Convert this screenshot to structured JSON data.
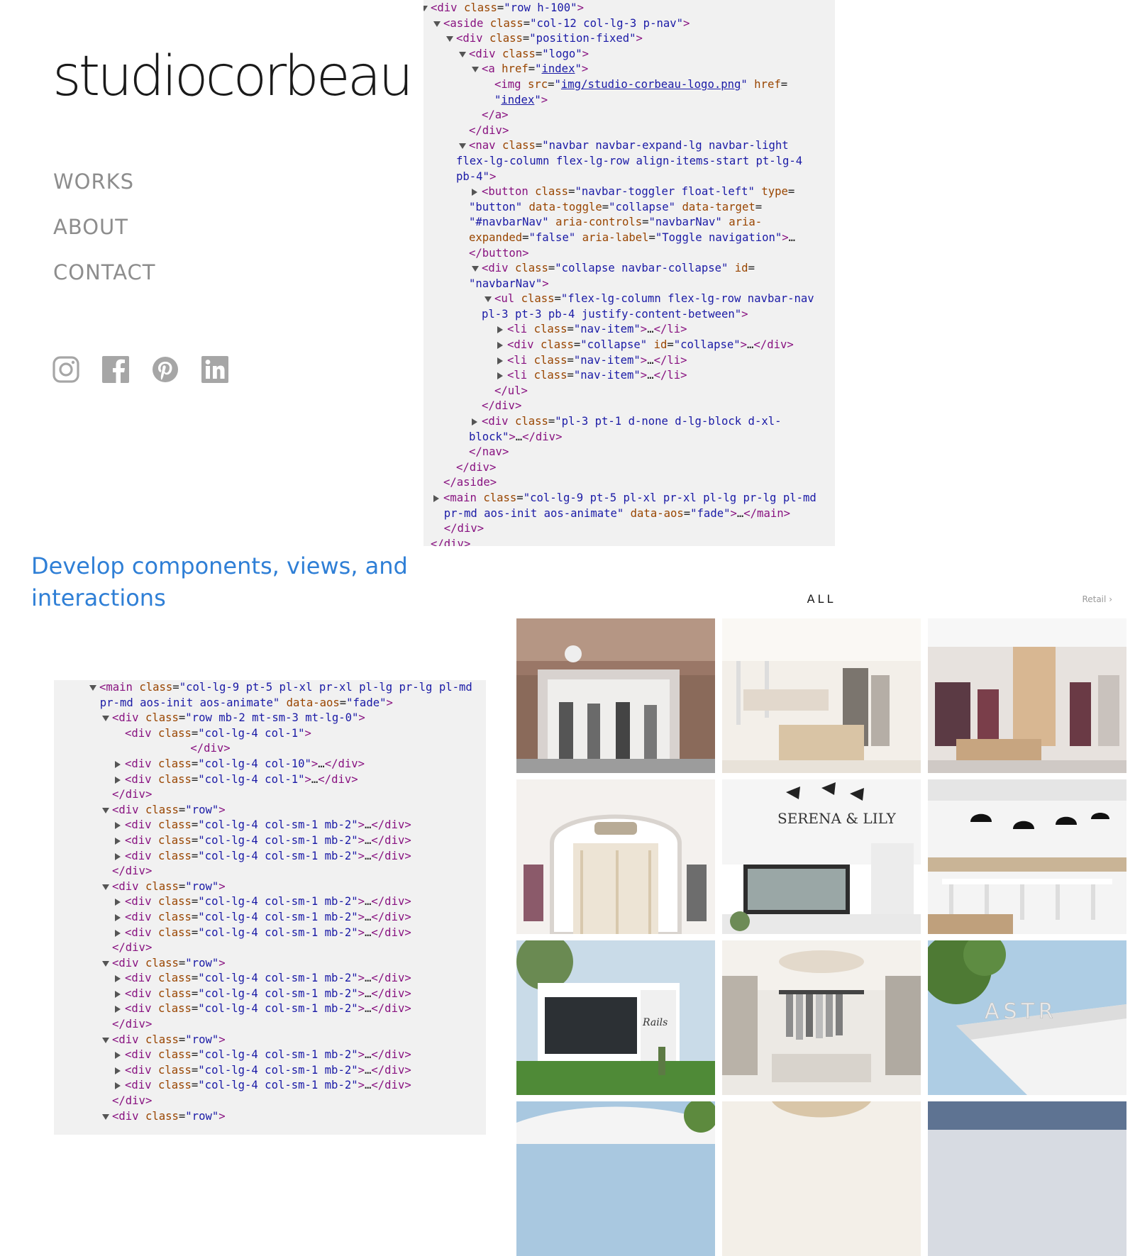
{
  "site": {
    "logo_text": "studiocorbeau",
    "nav": [
      "WORKS",
      "ABOUT",
      "CONTACT"
    ],
    "social_icons": [
      "instagram-icon",
      "facebook-icon",
      "pinterest-icon",
      "linkedin-icon"
    ]
  },
  "caption": "Develop components, views, and interactions",
  "gallery": {
    "filter_title": "ALL",
    "next_label": "Retail",
    "tile_count_visible_rows": 4
  },
  "devtools_top": [
    {
      "indent": 0,
      "toggle": "open",
      "html": "<span class='tg'>&lt;div</span> <span class='an'>class</span>=<span class='av'>\"row h-100\"</span><span class='tg'>&gt;</span>"
    },
    {
      "indent": 1,
      "toggle": "open",
      "html": "<span class='tg'>&lt;aside</span> <span class='an'>class</span>=<span class='av'>\"col-12 col-lg-3 p-nav\"</span><span class='tg'>&gt;</span>"
    },
    {
      "indent": 2,
      "toggle": "open",
      "html": "<span class='tg'>&lt;div</span> <span class='an'>class</span>=<span class='av'>\"position-fixed\"</span><span class='tg'>&gt;</span>"
    },
    {
      "indent": 3,
      "toggle": "open",
      "html": "<span class='tg'>&lt;div</span> <span class='an'>class</span>=<span class='av'>\"logo\"</span><span class='tg'>&gt;</span>"
    },
    {
      "indent": 4,
      "toggle": "open",
      "html": "<span class='tg'>&lt;a</span> <span class='an'>href</span>=<span class='av'>\"</span><span class='lnk'>index</span><span class='av'>\"</span><span class='tg'>&gt;</span>"
    },
    {
      "indent": 5,
      "toggle": "",
      "html": "<span class='tg'>&lt;img</span> <span class='an'>src</span>=<span class='av'>\"</span><span class='lnk'>img/studio-corbeau-logo.png</span><span class='av'>\"</span> <span class='an'>href</span>="
    },
    {
      "indent": 5,
      "toggle": "",
      "html": "<span class='av'>\"</span><span class='lnk'>index</span><span class='av'>\"</span><span class='tg'>&gt;</span>"
    },
    {
      "indent": 4,
      "toggle": "",
      "html": "<span class='tg'>&lt;/a&gt;</span>"
    },
    {
      "indent": 3,
      "toggle": "",
      "html": "<span class='tg'>&lt;/div&gt;</span>"
    },
    {
      "indent": 3,
      "toggle": "open",
      "html": "<span class='tg'>&lt;nav</span> <span class='an'>class</span>=<span class='av'>\"navbar navbar-expand-lg navbar-light</span>"
    },
    {
      "indent": 2,
      "toggle": "",
      "html": "<span class='av'>flex-lg-column flex-lg-row align-items-start pt-lg-4</span>"
    },
    {
      "indent": 2,
      "toggle": "",
      "html": "<span class='av'>pb-4\"</span><span class='tg'>&gt;</span>"
    },
    {
      "indent": 4,
      "toggle": "closed",
      "html": "<span class='tg'>&lt;button</span> <span class='an'>class</span>=<span class='av'>\"navbar-toggler float-left\"</span> <span class='an'>type</span>="
    },
    {
      "indent": 3,
      "toggle": "",
      "html": "<span class='av'>\"button\"</span> <span class='an'>data-toggle</span>=<span class='av'>\"collapse\"</span> <span class='an'>data-target</span>="
    },
    {
      "indent": 3,
      "toggle": "",
      "html": "<span class='av'>\"#navbarNav\"</span> <span class='an'>aria-controls</span>=<span class='av'>\"navbarNav\"</span> <span class='an'>aria-</span>"
    },
    {
      "indent": 3,
      "toggle": "",
      "html": "<span class='an'>expanded</span>=<span class='av'>\"false\"</span> <span class='an'>aria-label</span>=<span class='av'>\"Toggle navigation\"</span><span class='tg'>&gt;</span>…"
    },
    {
      "indent": 3,
      "toggle": "",
      "html": "<span class='tg'>&lt;/button&gt;</span>"
    },
    {
      "indent": 4,
      "toggle": "open",
      "html": "<span class='tg'>&lt;div</span> <span class='an'>class</span>=<span class='av'>\"collapse navbar-collapse\"</span> <span class='an'>id</span>="
    },
    {
      "indent": 3,
      "toggle": "",
      "html": "<span class='av'>\"navbarNav\"</span><span class='tg'>&gt;</span>"
    },
    {
      "indent": 5,
      "toggle": "open",
      "html": "<span class='tg'>&lt;ul</span> <span class='an'>class</span>=<span class='av'>\"flex-lg-column flex-lg-row navbar-nav</span>"
    },
    {
      "indent": 4,
      "toggle": "",
      "html": "<span class='av'>pl-3 pt-3 pb-4 justify-content-between\"</span><span class='tg'>&gt;</span>"
    },
    {
      "indent": 6,
      "toggle": "closed",
      "html": "<span class='tg'>&lt;li</span> <span class='an'>class</span>=<span class='av'>\"nav-item\"</span><span class='tg'>&gt;</span>…<span class='tg'>&lt;/li&gt;</span>"
    },
    {
      "indent": 6,
      "toggle": "closed",
      "html": "<span class='tg'>&lt;div</span> <span class='an'>class</span>=<span class='av'>\"collapse\"</span> <span class='an'>id</span>=<span class='av'>\"collapse\"</span><span class='tg'>&gt;</span>…<span class='tg'>&lt;/div&gt;</span>"
    },
    {
      "indent": 6,
      "toggle": "closed",
      "html": "<span class='tg'>&lt;li</span> <span class='an'>class</span>=<span class='av'>\"nav-item\"</span><span class='tg'>&gt;</span>…<span class='tg'>&lt;/li&gt;</span>"
    },
    {
      "indent": 6,
      "toggle": "closed",
      "html": "<span class='tg'>&lt;li</span> <span class='an'>class</span>=<span class='av'>\"nav-item\"</span><span class='tg'>&gt;</span>…<span class='tg'>&lt;/li&gt;</span>"
    },
    {
      "indent": 5,
      "toggle": "",
      "html": "<span class='tg'>&lt;/ul&gt;</span>"
    },
    {
      "indent": 4,
      "toggle": "",
      "html": "<span class='tg'>&lt;/div&gt;</span>"
    },
    {
      "indent": 4,
      "toggle": "closed",
      "html": "<span class='tg'>&lt;div</span> <span class='an'>class</span>=<span class='av'>\"pl-3 pt-1 d-none d-lg-block d-xl-</span>"
    },
    {
      "indent": 3,
      "toggle": "",
      "html": "<span class='av'>block\"</span><span class='tg'>&gt;</span>…<span class='tg'>&lt;/div&gt;</span>"
    },
    {
      "indent": 3,
      "toggle": "",
      "html": "<span class='tg'>&lt;/nav&gt;</span>"
    },
    {
      "indent": 2,
      "toggle": "",
      "html": "<span class='tg'>&lt;/div&gt;</span>"
    },
    {
      "indent": 1,
      "toggle": "",
      "html": "<span class='tg'>&lt;/aside&gt;</span>"
    },
    {
      "indent": 1,
      "toggle": "closed",
      "html": "<span class='tg'>&lt;main</span> <span class='an'>class</span>=<span class='av'>\"col-lg-9 pt-5 pl-xl pr-xl pl-lg pr-lg pl-md</span>"
    },
    {
      "indent": 0,
      "toggle": "",
      "html": "<span class='av'>  pr-md aos-init aos-animate\"</span> <span class='an'>data-aos</span>=<span class='av'>\"fade\"</span><span class='tg'>&gt;</span>…<span class='tg'>&lt;/main&gt;</span>"
    },
    {
      "indent": 0,
      "toggle": "",
      "html": "<span class='tg'>  &lt;/div&gt;</span>"
    },
    {
      "indent": 0,
      "toggle": "",
      "html": "<span class='tg'>&lt;/div&gt;</span>"
    }
  ],
  "devtools_bottom": [
    {
      "indent": 1,
      "toggle": "open",
      "html": "<span class='tg'>&lt;main</span> <span class='an'>class</span>=<span class='av'>\"col-lg-9 pt-5 pl-xl pr-xl pl-lg pr-lg pl-md</span>"
    },
    {
      "indent": 0,
      "toggle": "",
      "html": "<span class='av'>  pr-md aos-init aos-animate\"</span> <span class='an'>data-aos</span>=<span class='av'>\"fade\"</span><span class='tg'>&gt;</span>"
    },
    {
      "indent": 2,
      "toggle": "open",
      "html": "<span class='tg'>&lt;div</span> <span class='an'>class</span>=<span class='av'>\"row mb-2 mt-sm-3 mt-lg-0\"</span><span class='tg'>&gt;</span>"
    },
    {
      "indent": 3,
      "toggle": "",
      "html": "<span class='tg'>&lt;div</span> <span class='an'>class</span>=<span class='av'>\"col-lg-4 col-1\"</span><span class='tg'>&gt;</span>"
    },
    {
      "indent": 5,
      "toggle": "",
      "html": "      <span class='tg'>&lt;/div&gt;</span>"
    },
    {
      "indent": 3,
      "toggle": "closed",
      "html": "<span class='tg'>&lt;div</span> <span class='an'>class</span>=<span class='av'>\"col-lg-4 col-10\"</span><span class='tg'>&gt;</span>…<span class='tg'>&lt;/div&gt;</span>"
    },
    {
      "indent": 3,
      "toggle": "closed",
      "html": "<span class='tg'>&lt;div</span> <span class='an'>class</span>=<span class='av'>\"col-lg-4 col-1\"</span><span class='tg'>&gt;</span>…<span class='tg'>&lt;/div&gt;</span>"
    },
    {
      "indent": 2,
      "toggle": "",
      "html": "<span class='tg'>&lt;/div&gt;</span>"
    },
    {
      "indent": 2,
      "toggle": "open",
      "html": "<span class='tg'>&lt;div</span> <span class='an'>class</span>=<span class='av'>\"row\"</span><span class='tg'>&gt;</span>"
    },
    {
      "indent": 3,
      "toggle": "closed",
      "html": "<span class='tg'>&lt;div</span> <span class='an'>class</span>=<span class='av'>\"col-lg-4 col-sm-1 mb-2\"</span><span class='tg'>&gt;</span>…<span class='tg'>&lt;/div&gt;</span>"
    },
    {
      "indent": 3,
      "toggle": "closed",
      "html": "<span class='tg'>&lt;div</span> <span class='an'>class</span>=<span class='av'>\"col-lg-4 col-sm-1 mb-2\"</span><span class='tg'>&gt;</span>…<span class='tg'>&lt;/div&gt;</span>"
    },
    {
      "indent": 3,
      "toggle": "closed",
      "html": "<span class='tg'>&lt;div</span> <span class='an'>class</span>=<span class='av'>\"col-lg-4 col-sm-1 mb-2\"</span><span class='tg'>&gt;</span>…<span class='tg'>&lt;/div&gt;</span>"
    },
    {
      "indent": 2,
      "toggle": "",
      "html": "<span class='tg'>&lt;/div&gt;</span>"
    },
    {
      "indent": 2,
      "toggle": "open",
      "html": "<span class='tg'>&lt;div</span> <span class='an'>class</span>=<span class='av'>\"row\"</span><span class='tg'>&gt;</span>"
    },
    {
      "indent": 3,
      "toggle": "closed",
      "html": "<span class='tg'>&lt;div</span> <span class='an'>class</span>=<span class='av'>\"col-lg-4 col-sm-1 mb-2\"</span><span class='tg'>&gt;</span>…<span class='tg'>&lt;/div&gt;</span>"
    },
    {
      "indent": 3,
      "toggle": "closed",
      "html": "<span class='tg'>&lt;div</span> <span class='an'>class</span>=<span class='av'>\"col-lg-4 col-sm-1 mb-2\"</span><span class='tg'>&gt;</span>…<span class='tg'>&lt;/div&gt;</span>"
    },
    {
      "indent": 3,
      "toggle": "closed",
      "html": "<span class='tg'>&lt;div</span> <span class='an'>class</span>=<span class='av'>\"col-lg-4 col-sm-1 mb-2\"</span><span class='tg'>&gt;</span>…<span class='tg'>&lt;/div&gt;</span>"
    },
    {
      "indent": 2,
      "toggle": "",
      "html": "<span class='tg'>&lt;/div&gt;</span>"
    },
    {
      "indent": 2,
      "toggle": "open",
      "html": "<span class='tg'>&lt;div</span> <span class='an'>class</span>=<span class='av'>\"row\"</span><span class='tg'>&gt;</span>"
    },
    {
      "indent": 3,
      "toggle": "closed",
      "html": "<span class='tg'>&lt;div</span> <span class='an'>class</span>=<span class='av'>\"col-lg-4 col-sm-1 mb-2\"</span><span class='tg'>&gt;</span>…<span class='tg'>&lt;/div&gt;</span>"
    },
    {
      "indent": 3,
      "toggle": "closed",
      "html": "<span class='tg'>&lt;div</span> <span class='an'>class</span>=<span class='av'>\"col-lg-4 col-sm-1 mb-2\"</span><span class='tg'>&gt;</span>…<span class='tg'>&lt;/div&gt;</span>"
    },
    {
      "indent": 3,
      "toggle": "closed",
      "html": "<span class='tg'>&lt;div</span> <span class='an'>class</span>=<span class='av'>\"col-lg-4 col-sm-1 mb-2\"</span><span class='tg'>&gt;</span>…<span class='tg'>&lt;/div&gt;</span>"
    },
    {
      "indent": 2,
      "toggle": "",
      "html": "<span class='tg'>&lt;/div&gt;</span>"
    },
    {
      "indent": 2,
      "toggle": "open",
      "html": "<span class='tg'>&lt;div</span> <span class='an'>class</span>=<span class='av'>\"row\"</span><span class='tg'>&gt;</span>"
    },
    {
      "indent": 3,
      "toggle": "closed",
      "html": "<span class='tg'>&lt;div</span> <span class='an'>class</span>=<span class='av'>\"col-lg-4 col-sm-1 mb-2\"</span><span class='tg'>&gt;</span>…<span class='tg'>&lt;/div&gt;</span>"
    },
    {
      "indent": 3,
      "toggle": "closed",
      "html": "<span class='tg'>&lt;div</span> <span class='an'>class</span>=<span class='av'>\"col-lg-4 col-sm-1 mb-2\"</span><span class='tg'>&gt;</span>…<span class='tg'>&lt;/div&gt;</span>"
    },
    {
      "indent": 3,
      "toggle": "closed",
      "html": "<span class='tg'>&lt;div</span> <span class='an'>class</span>=<span class='av'>\"col-lg-4 col-sm-1 mb-2\"</span><span class='tg'>&gt;</span>…<span class='tg'>&lt;/div&gt;</span>"
    },
    {
      "indent": 2,
      "toggle": "",
      "html": "<span class='tg'>&lt;/div&gt;</span>"
    },
    {
      "indent": 2,
      "toggle": "open",
      "html": "<span class='tg'>&lt;div</span> <span class='an'>class</span>=<span class='av'>\"row\"</span><span class='tg'>&gt;</span>"
    }
  ]
}
